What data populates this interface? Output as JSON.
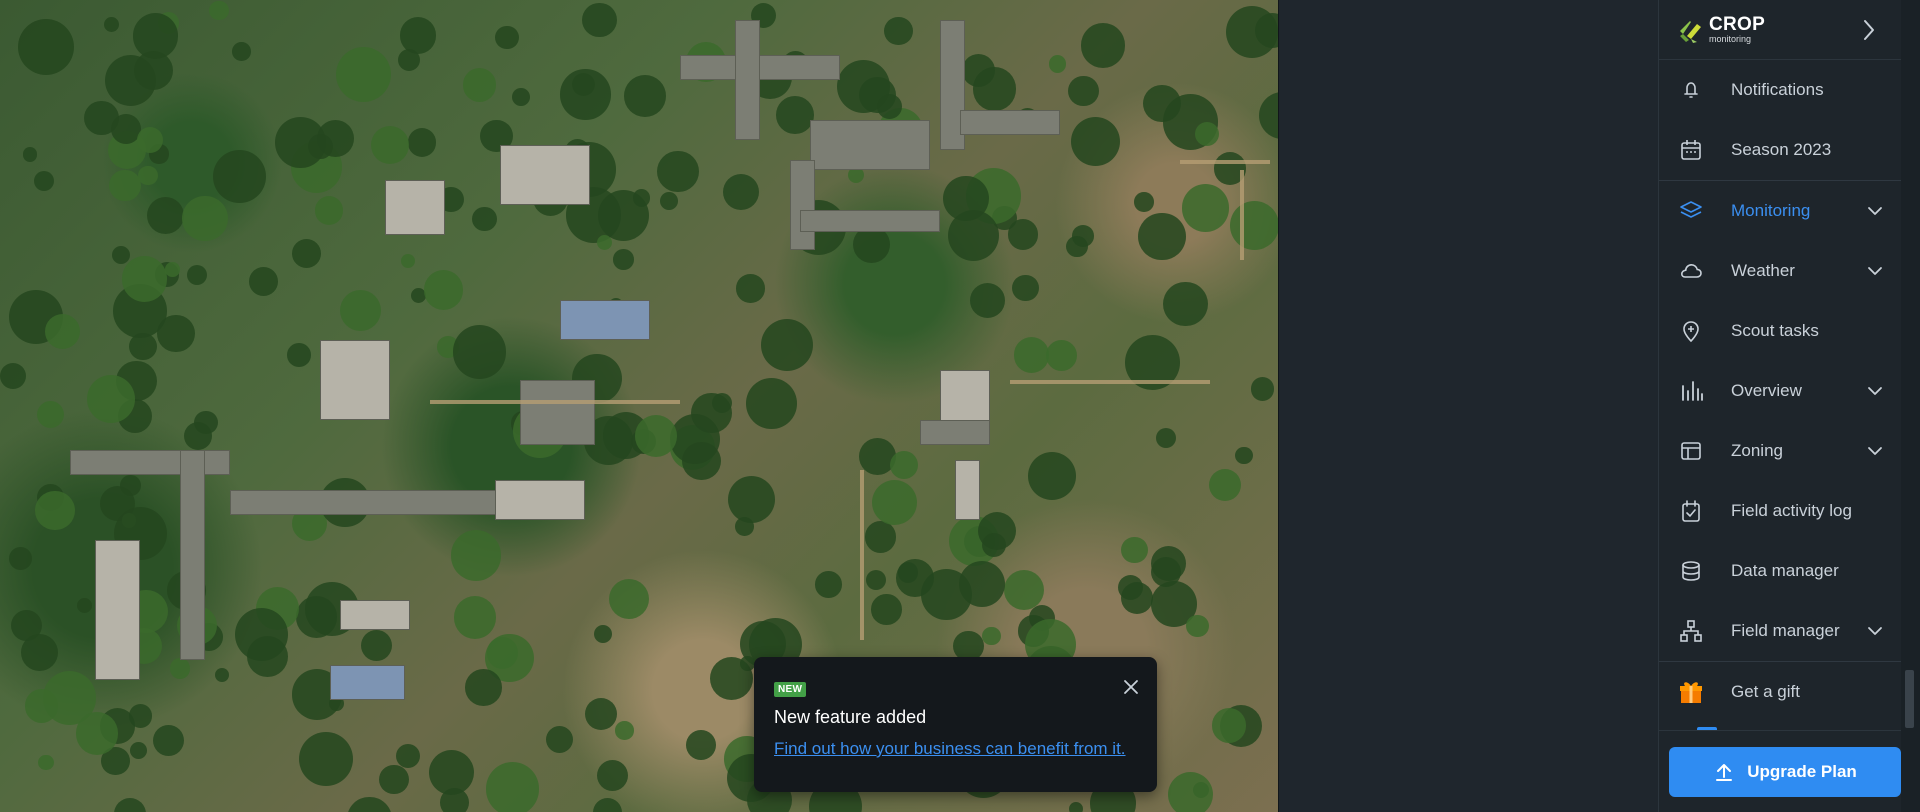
{
  "brand": {
    "title": "CROP",
    "subtitle": "monitoring"
  },
  "sidebar": {
    "collapse_icon": "chevron-right-icon",
    "items": [
      {
        "label": "Notifications",
        "icon": "bell-icon",
        "has_chevron": false,
        "active": false
      },
      {
        "label": "Season 2023",
        "icon": "calendar-icon",
        "has_chevron": false,
        "active": false
      },
      {
        "label": "Monitoring",
        "icon": "layers-icon",
        "has_chevron": true,
        "active": true
      },
      {
        "label": "Weather",
        "icon": "cloud-icon",
        "has_chevron": true,
        "active": false
      },
      {
        "label": "Scout tasks",
        "icon": "map-pin-icon",
        "has_chevron": false,
        "active": false
      },
      {
        "label": "Overview",
        "icon": "bar-chart-icon",
        "has_chevron": true,
        "active": false
      },
      {
        "label": "Zoning",
        "icon": "layout-icon",
        "has_chevron": true,
        "active": false
      },
      {
        "label": "Field activity log",
        "icon": "calendar-check-icon",
        "has_chevron": false,
        "active": false
      },
      {
        "label": "Data manager",
        "icon": "database-icon",
        "has_chevron": false,
        "active": false
      },
      {
        "label": "Field manager",
        "icon": "hierarchy-icon",
        "has_chevron": true,
        "active": false
      }
    ],
    "gift_label": "Get a gift",
    "upgrade_label": "Upgrade Plan"
  },
  "popup": {
    "badge": "NEW",
    "title": "New feature added",
    "link": "Find out how your business can benefit from it."
  },
  "colors": {
    "accent": "#3b8ff0",
    "button": "#2f8cf2",
    "sidebar_bg": "#1e252b",
    "badge_green": "#43a047"
  }
}
